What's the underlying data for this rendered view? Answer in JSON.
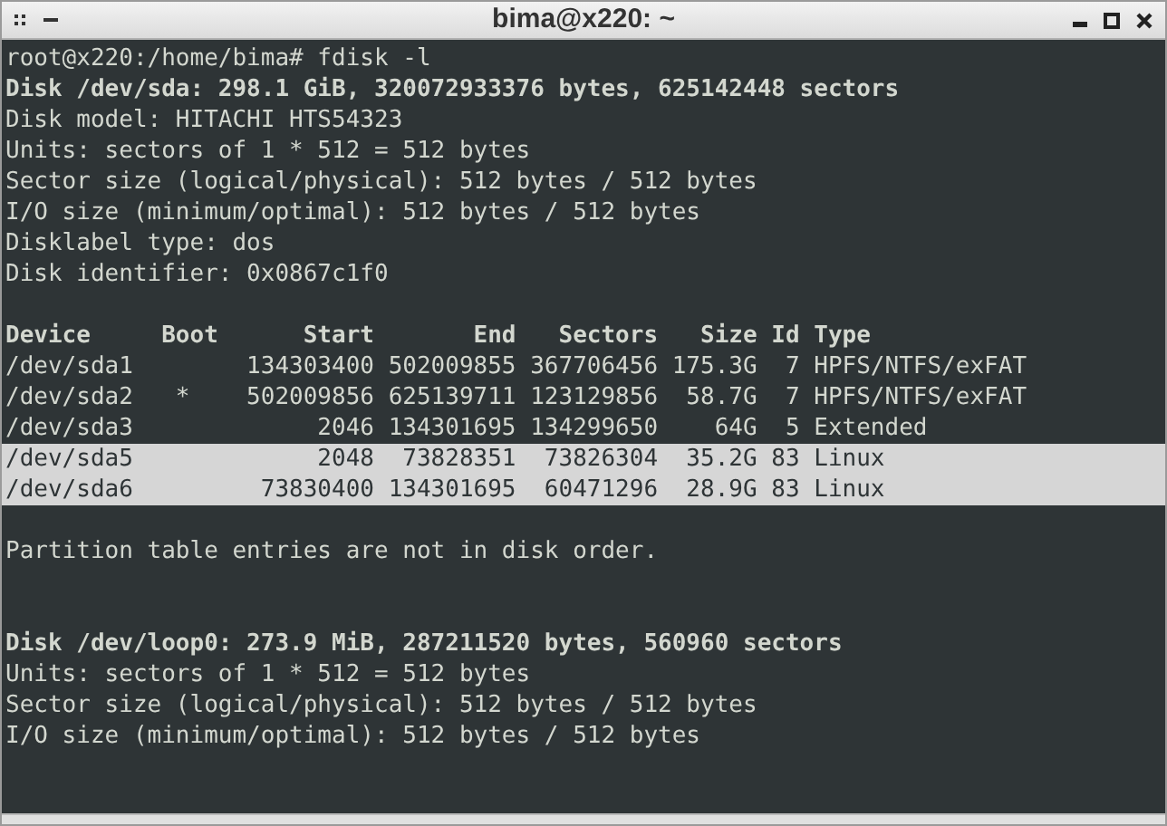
{
  "window": {
    "title": "bima@x220: ~"
  },
  "terminal": {
    "lines": [
      {
        "kind": "text",
        "text": "root@x220:/home/bima# fdisk -l",
        "bold": false,
        "selected": false
      },
      {
        "kind": "text",
        "text": "Disk /dev/sda: 298.1 GiB, 320072933376 bytes, 625142448 sectors",
        "bold": true,
        "selected": false
      },
      {
        "kind": "text",
        "text": "Disk model: HITACHI HTS54323",
        "bold": false,
        "selected": false
      },
      {
        "kind": "text",
        "text": "Units: sectors of 1 * 512 = 512 bytes",
        "bold": false,
        "selected": false
      },
      {
        "kind": "text",
        "text": "Sector size (logical/physical): 512 bytes / 512 bytes",
        "bold": false,
        "selected": false
      },
      {
        "kind": "text",
        "text": "I/O size (minimum/optimal): 512 bytes / 512 bytes",
        "bold": false,
        "selected": false
      },
      {
        "kind": "text",
        "text": "Disklabel type: dos",
        "bold": false,
        "selected": false
      },
      {
        "kind": "text",
        "text": "Disk identifier: 0x0867c1f0",
        "bold": false,
        "selected": false
      },
      {
        "kind": "blank"
      },
      {
        "kind": "text",
        "text": "Device     Boot      Start       End   Sectors   Size Id Type",
        "bold": true,
        "selected": false
      },
      {
        "kind": "text",
        "text": "/dev/sda1        134303400 502009855 367706456 175.3G  7 HPFS/NTFS/exFAT",
        "bold": false,
        "selected": false
      },
      {
        "kind": "text",
        "text": "/dev/sda2   *    502009856 625139711 123129856  58.7G  7 HPFS/NTFS/exFAT",
        "bold": false,
        "selected": false
      },
      {
        "kind": "text",
        "text": "/dev/sda3             2046 134301695 134299650    64G  5 Extended",
        "bold": false,
        "selected": false
      },
      {
        "kind": "text",
        "text": "/dev/sda5             2048  73828351  73826304  35.2G 83 Linux",
        "bold": false,
        "selected": true
      },
      {
        "kind": "text",
        "text": "/dev/sda6         73830400 134301695  60471296  28.9G 83 Linux",
        "bold": false,
        "selected": true
      },
      {
        "kind": "blank"
      },
      {
        "kind": "text",
        "text": "Partition table entries are not in disk order.",
        "bold": false,
        "selected": false
      },
      {
        "kind": "blank"
      },
      {
        "kind": "blank"
      },
      {
        "kind": "text",
        "text": "Disk /dev/loop0: 273.9 MiB, 287211520 bytes, 560960 sectors",
        "bold": true,
        "selected": false
      },
      {
        "kind": "text",
        "text": "Units: sectors of 1 * 512 = 512 bytes",
        "bold": false,
        "selected": false
      },
      {
        "kind": "text",
        "text": "Sector size (logical/physical): 512 bytes / 512 bytes",
        "bold": false,
        "selected": false
      },
      {
        "kind": "text",
        "text": "I/O size (minimum/optimal): 512 bytes / 512 bytes",
        "bold": false,
        "selected": false
      }
    ]
  }
}
